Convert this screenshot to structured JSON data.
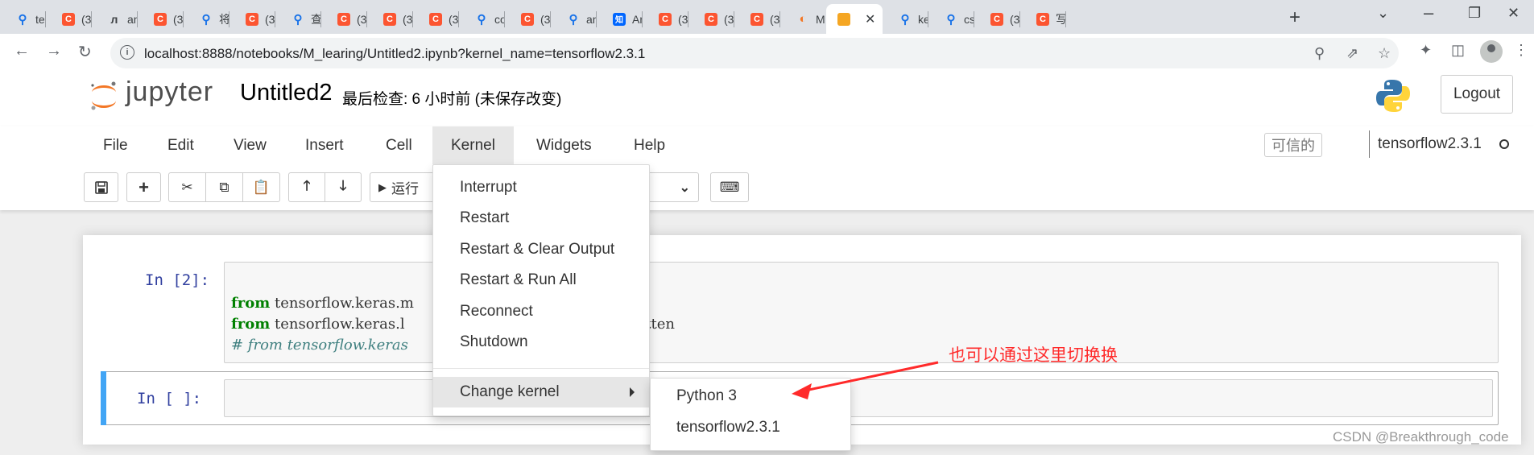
{
  "browser": {
    "tabs": [
      {
        "icon": "search-icon",
        "label": "ter"
      },
      {
        "icon": "csdn-icon",
        "label": "(3("
      },
      {
        "icon": "anaconda-icon",
        "label": "an"
      },
      {
        "icon": "csdn-icon",
        "label": "(3("
      },
      {
        "icon": "search-icon",
        "label": "将("
      },
      {
        "icon": "csdn-icon",
        "label": "(3("
      },
      {
        "icon": "search-icon",
        "label": "查("
      },
      {
        "icon": "csdn-icon",
        "label": "(3("
      },
      {
        "icon": "csdn-icon",
        "label": "(3("
      },
      {
        "icon": "csdn-icon",
        "label": "(3("
      },
      {
        "icon": "search-icon",
        "label": "co"
      },
      {
        "icon": "csdn-icon",
        "label": "(3("
      },
      {
        "icon": "search-icon",
        "label": "an"
      },
      {
        "icon": "zhihu-icon",
        "label": "An"
      },
      {
        "icon": "csdn-icon",
        "label": "(3("
      },
      {
        "icon": "csdn-icon",
        "label": "(3("
      },
      {
        "icon": "csdn-icon",
        "label": "(3("
      },
      {
        "icon": "jupyter-icon",
        "label": "M"
      },
      {
        "icon": "notebook-icon",
        "label": "",
        "active": true
      },
      {
        "icon": "search-icon",
        "label": "ke"
      },
      {
        "icon": "search-icon",
        "label": "cs("
      },
      {
        "icon": "csdn-icon",
        "label": "(3("
      },
      {
        "icon": "csdn-icon",
        "label": "写"
      }
    ],
    "url": "localhost:8888/notebooks/M_learing/Untitled2.ipynb?kernel_name=tensorflow2.3.1"
  },
  "jupyter": {
    "logo_text": "jupyter",
    "notebook_name": "Untitled2",
    "checkpoint": "最后检查: 6 小时前   (未保存改变)",
    "logout_label": "Logout",
    "menu": [
      "File",
      "Edit",
      "View",
      "Insert",
      "Cell",
      "Kernel",
      "Widgets",
      "Help"
    ],
    "trusted_label": "可信的",
    "kernel_name": "tensorflow2.3.1",
    "toolbar": {
      "run_label": "运行"
    }
  },
  "kernel_menu": {
    "items": [
      "Interrupt",
      "Restart",
      "Restart & Clear Output",
      "Restart & Run All",
      "Reconnect",
      "Shutdown"
    ],
    "change_kernel": "Change kernel"
  },
  "kernel_submenu": {
    "items": [
      "Python 3",
      "tensorflow2.3.1"
    ]
  },
  "cells": [
    {
      "prompt": "In  [2]:",
      "lines": [
        {
          "kw": "from",
          "rest": " tensorflow.keras.m"
        },
        {
          "kw": "from",
          "rest": " tensorflow.keras.l                   Pooling2D,Dense,Flatten"
        },
        {
          "comment": "# from tensorflow.keras                   xPooling2D"
        }
      ]
    },
    {
      "prompt": "In  [ ]:"
    }
  ],
  "annotation": {
    "text": "也可以通过这里切换换",
    "color": "#ff2a2a"
  },
  "watermark": "CSDN @Breakthrough_code"
}
